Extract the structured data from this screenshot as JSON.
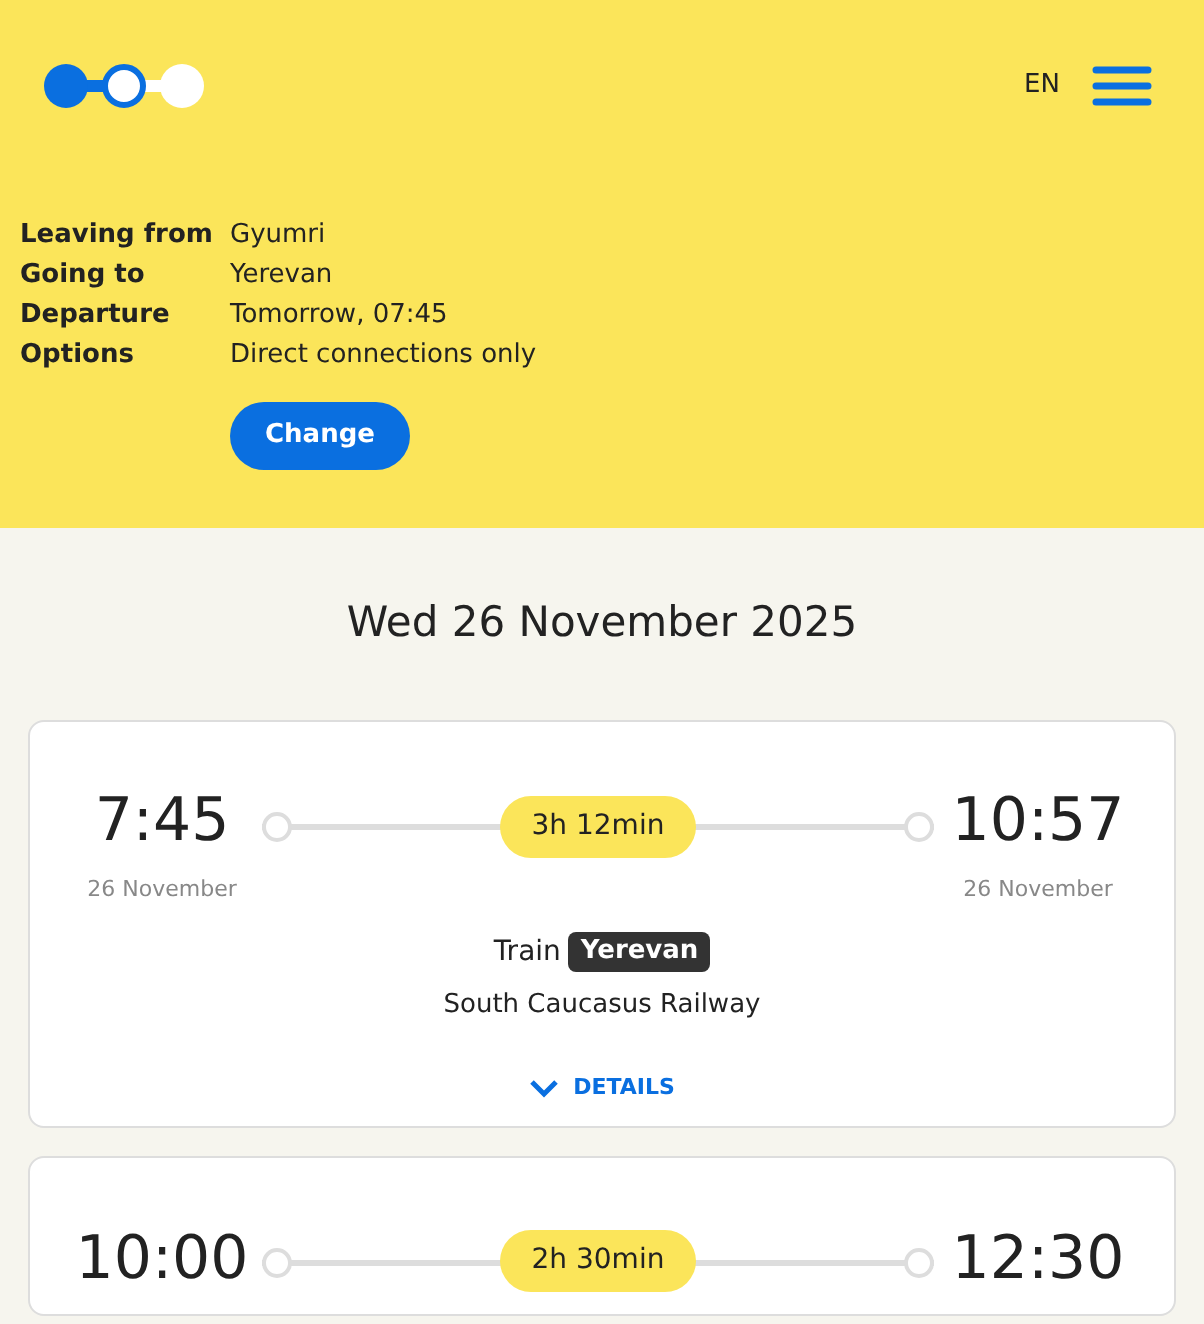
{
  "header": {
    "language": "EN"
  },
  "summary": [
    {
      "label": "Leaving from",
      "value": "Gyumri"
    },
    {
      "label": "Going to",
      "value": "Yerevan"
    },
    {
      "label": "Departure",
      "value": "Tomorrow, 07:45"
    },
    {
      "label": "Options",
      "value": "Direct connections only"
    }
  ],
  "change_button": "Change",
  "date_heading": "Wed 26 November 2025",
  "connections": [
    {
      "departure": "7:45",
      "departure_date": "26 November",
      "duration": "3h 12min",
      "arrival": "10:57",
      "arrival_date": "26 November",
      "mode": "Train",
      "train_name": "Yerevan",
      "operator": "South Caucasus Railway",
      "details": "DETAILS"
    },
    {
      "departure": "10:00",
      "duration": "2h 30min",
      "arrival": "12:30"
    }
  ]
}
